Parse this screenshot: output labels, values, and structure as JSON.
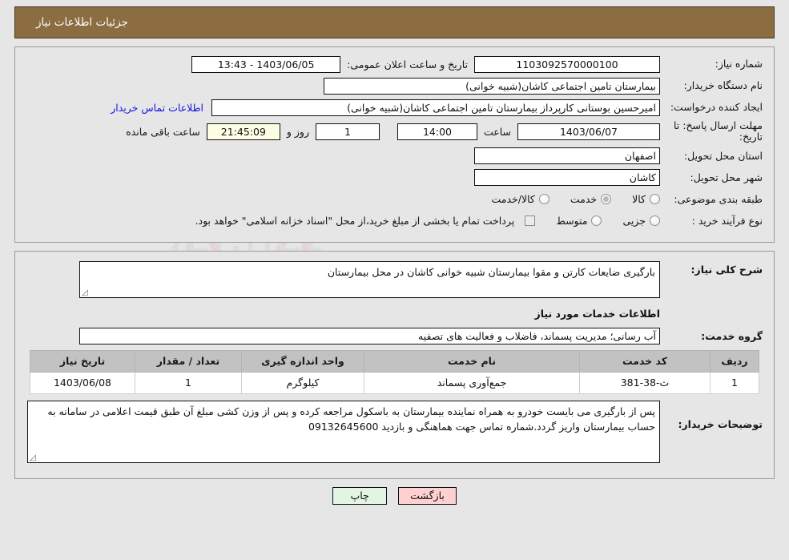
{
  "header": {
    "title": "جزئیات اطلاعات نیاز",
    "bar_color": "#8c6d42"
  },
  "form": {
    "need_no_label": "شماره نیاز:",
    "need_no_value": "1103092570000100",
    "announce_label": "تاریخ و ساعت اعلان عمومی:",
    "announce_value": "1403/06/05 - 13:43",
    "org_label": "نام دستگاه خریدار:",
    "org_value": "بیمارستان تامین اجتماعی کاشان(شبیه خوانی)",
    "creator_label": "ایجاد کننده درخواست:",
    "creator_value": "امیرحسین بوستانی کارپرداز بیمارستان تامین اجتماعی کاشان(شبیه خوانی)",
    "contact_link": "اطلاعات تماس خریدار",
    "deadline_label": "مهلت ارسال پاسخ: تا تاریخ:",
    "deadline_date": "1403/06/07",
    "hour_label": "ساعت",
    "deadline_time": "14:00",
    "days_value": "1",
    "days_label": "روز و",
    "remaining_value": "21:45:09",
    "remaining_label": "ساعت باقی مانده",
    "province_label": "استان محل تحویل:",
    "province_value": "اصفهان",
    "city_label": "شهر محل تحویل:",
    "city_value": "کاشان",
    "category_label": "طبقه بندی موضوعی:",
    "category_options": [
      {
        "label": "کالا",
        "selected": false
      },
      {
        "label": "خدمت",
        "selected": true
      },
      {
        "label": "کالا/خدمت",
        "selected": false
      }
    ],
    "process_label": "نوع فرآیند خرید :",
    "process_options": [
      {
        "label": "جزیی",
        "selected": false
      },
      {
        "label": "متوسط",
        "selected": false
      }
    ],
    "treasury_checkbox_text": "پرداخت تمام یا بخشی از مبلغ خرید،از محل \"اسناد خزانه اسلامی\" خواهد بود.",
    "treasury_checked": false
  },
  "need": {
    "label": "شرح کلی نیاز:",
    "value": "بارگیری ضایعات کارتن و مقوا بیمارستان شبیه خوانی کاشان در محل بیمارستان",
    "section_title": "اطلاعات خدمات مورد نیاز",
    "service_group_label": "گروه خدمت:",
    "service_group_value": "آب رسانی؛ مدیریت پسماند، فاضلاب و فعالیت های تصفیه"
  },
  "table": {
    "columns": [
      "ردیف",
      "کد خدمت",
      "نام خدمت",
      "واحد اندازه گیری",
      "تعداد / مقدار",
      "تاریخ نیاز"
    ],
    "rows": [
      {
        "radif": "1",
        "code": "ث-38-381",
        "name": "جمع‌آوری پسماند",
        "unit": "کیلوگرم",
        "qty": "1",
        "date": "1403/06/08"
      }
    ]
  },
  "comments": {
    "label": "توضیحات خریدار:",
    "value": "پس از بارگیری می بایست خودرو به همراه نماینده بیمارستان به باسکول مراجعه کرده و پس از وزن کشی مبلغ آن طبق قیمت اعلامی در سامانه به حساب بیمارستان واریز گردد.شماره تماس جهت هماهنگی و بازدید 09132645600"
  },
  "footer": {
    "print_label": "چاپ",
    "back_label": "بازگشت"
  },
  "watermark": {
    "text": "AriaTender.net"
  }
}
